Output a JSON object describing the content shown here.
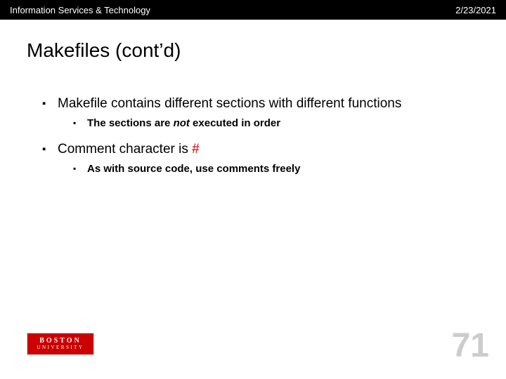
{
  "header": {
    "org": "Information Services & Technology",
    "date": "2/23/2021"
  },
  "title": "Makefiles (cont’d)",
  "bullets": {
    "b1a": "Makefile contains different sections with different functions",
    "b2a_pre": "The sections are ",
    "b2a_em": "not",
    "b2a_post": " executed in order",
    "b1b_pre": "Comment character is ",
    "b1b_hash": "#",
    "b2b": "As with source code, use comments freely"
  },
  "logo": {
    "top": "BOSTON",
    "bot": "UNIVERSITY"
  },
  "page": "71"
}
